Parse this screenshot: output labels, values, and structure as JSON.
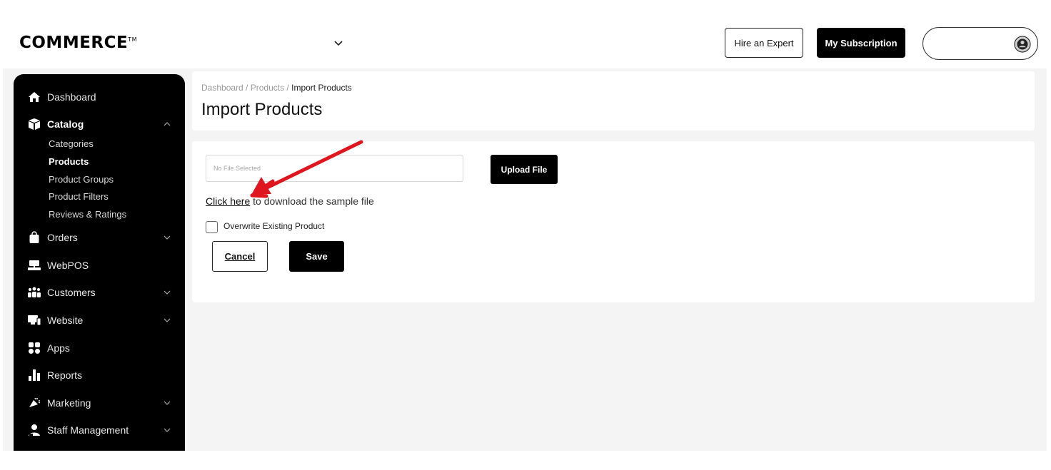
{
  "brand": {
    "logo_text": "COMMERCE",
    "logo_tm": "TM"
  },
  "topbar": {
    "store_selector_icon": "chevron-down-icon",
    "hire_expert_label": "Hire an Expert",
    "subscription_label": "My Subscription",
    "profile_icon": "user-circle-icon"
  },
  "sidebar": {
    "items": [
      {
        "label": "Dashboard",
        "icon": "home-icon"
      },
      {
        "label": "Catalog",
        "icon": "box-icon",
        "expanded": true
      },
      {
        "label": "Orders",
        "icon": "shopping-bag-icon"
      },
      {
        "label": "WebPOS",
        "icon": "pos-terminal-icon"
      },
      {
        "label": "Customers",
        "icon": "users-icon"
      },
      {
        "label": "Website",
        "icon": "monitor-icon"
      },
      {
        "label": "Apps",
        "icon": "apps-grid-icon"
      },
      {
        "label": "Reports",
        "icon": "bar-chart-icon"
      },
      {
        "label": "Marketing",
        "icon": "megaphone-icon"
      },
      {
        "label": "Staff Management",
        "icon": "staff-icon"
      }
    ],
    "catalog_sub": [
      {
        "label": "Categories"
      },
      {
        "label": "Products",
        "active": true
      },
      {
        "label": "Product Groups"
      },
      {
        "label": "Product Filters"
      },
      {
        "label": "Reviews & Ratings"
      }
    ]
  },
  "breadcrumb": {
    "items": [
      "Dashboard",
      "Products",
      "Import Products"
    ],
    "separator": " / "
  },
  "page": {
    "title": "Import Products"
  },
  "form": {
    "file_placeholder": "No File Selected",
    "upload_label": "Upload File",
    "sample_link": "Click here",
    "sample_text": " to download the sample file",
    "overwrite_label": "Overwrite Existing Product",
    "overwrite_checked": false,
    "cancel_label": "Cancel",
    "save_label": "Save"
  },
  "colors": {
    "accent": "#000000",
    "annotation_arrow": "#e0161e",
    "background": "#f4f4f4"
  }
}
